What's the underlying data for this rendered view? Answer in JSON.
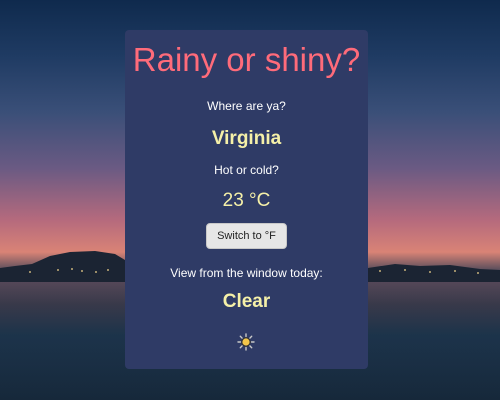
{
  "app": {
    "title": "Rainy or shiny?"
  },
  "location": {
    "label": "Where are ya?",
    "value": "Virginia"
  },
  "temperature": {
    "label": "Hot or cold?",
    "value": "23 °C",
    "switch_label": "Switch to °F"
  },
  "conditions": {
    "label": "View from the window today:",
    "value": "Clear",
    "icon": "sun-icon"
  },
  "colors": {
    "card_background": "#2f3b66",
    "title": "#ff6b7a",
    "highlight_value": "#f5f0a8",
    "button_background": "#e6e6e6"
  }
}
